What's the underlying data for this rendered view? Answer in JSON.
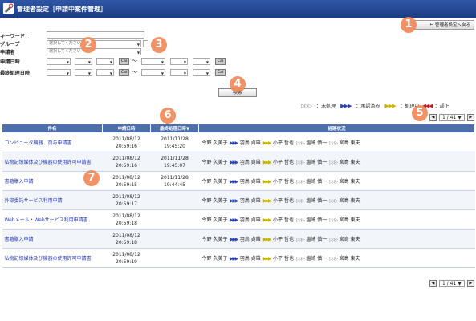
{
  "header": {
    "title": "管理者設定［申請中案件管理］"
  },
  "back_button": {
    "label": "管理者設定へ戻る"
  },
  "form": {
    "keyword_label": "キーワード：",
    "group_label": "グループ",
    "group_placeholder": "選択してください",
    "applicant_label": "申請者",
    "applicant_placeholder": "選択してください",
    "date_label": "申請日時",
    "final_date_label": "最終処理日時",
    "cal_label": "Cal",
    "tilde": "〜",
    "search_label": "検索"
  },
  "badges": [
    "1",
    "2",
    "3",
    "4",
    "5",
    "6",
    "7"
  ],
  "legend": {
    "unprocessed": "：未処理",
    "approved": "：承認済み",
    "pending": "：処理中",
    "rejected": "：却下",
    "arrows": "▷▷▷",
    "arrows_filled": "▶▶▶",
    "arrows_back": "◀◀◀"
  },
  "pager": {
    "current": "1 / 41",
    "prev": "◀",
    "next": "▶",
    "dropdown": "▼"
  },
  "table": {
    "headers": [
      "件名",
      "申請日時",
      "最終処理日時▼",
      "経路状況"
    ],
    "rows": [
      {
        "name": "コンピュータ機器　貸与申請書",
        "d1": "2011/08/12",
        "t1": "20:59:16",
        "d2": "2011/11/28",
        "t2": "19:45:20"
      },
      {
        "name": "私物記憶媒体及び機器の使用許可申請書",
        "d1": "2011/08/12",
        "t1": "20:59:16",
        "d2": "2011/11/28",
        "t2": "19:45:07"
      },
      {
        "name": "書籍購入申請",
        "d1": "2011/08/12",
        "t1": "20:59:15",
        "d2": "2011/11/28",
        "t2": "19:44:45"
      },
      {
        "name": "外部委託サービス利用申請",
        "d1": "2011/08/12",
        "t1": "20:59:17",
        "d2": "",
        "t2": ""
      },
      {
        "name": "Webメール・Webサービス利用申請書",
        "d1": "2011/08/12",
        "t1": "20:59:18",
        "d2": "",
        "t2": ""
      },
      {
        "name": "書籍購入申請",
        "d1": "2011/08/12",
        "t1": "20:59:18",
        "d2": "",
        "t2": ""
      },
      {
        "name": "私物記憶媒体及び機器の使用許可申請書",
        "d1": "2011/08/12",
        "t1": "20:59:19",
        "d2": "",
        "t2": ""
      }
    ],
    "route_people": [
      "今野 久美子",
      "羽鳥 貞雄",
      "小平 哲也",
      "塩崎 慎一",
      "宮島 東夫"
    ]
  },
  "colors": {
    "header_bg": "#2f56a6",
    "th_bg": "#4d6fae",
    "link": "#2a3fb0",
    "badge": "#f08a5a"
  }
}
